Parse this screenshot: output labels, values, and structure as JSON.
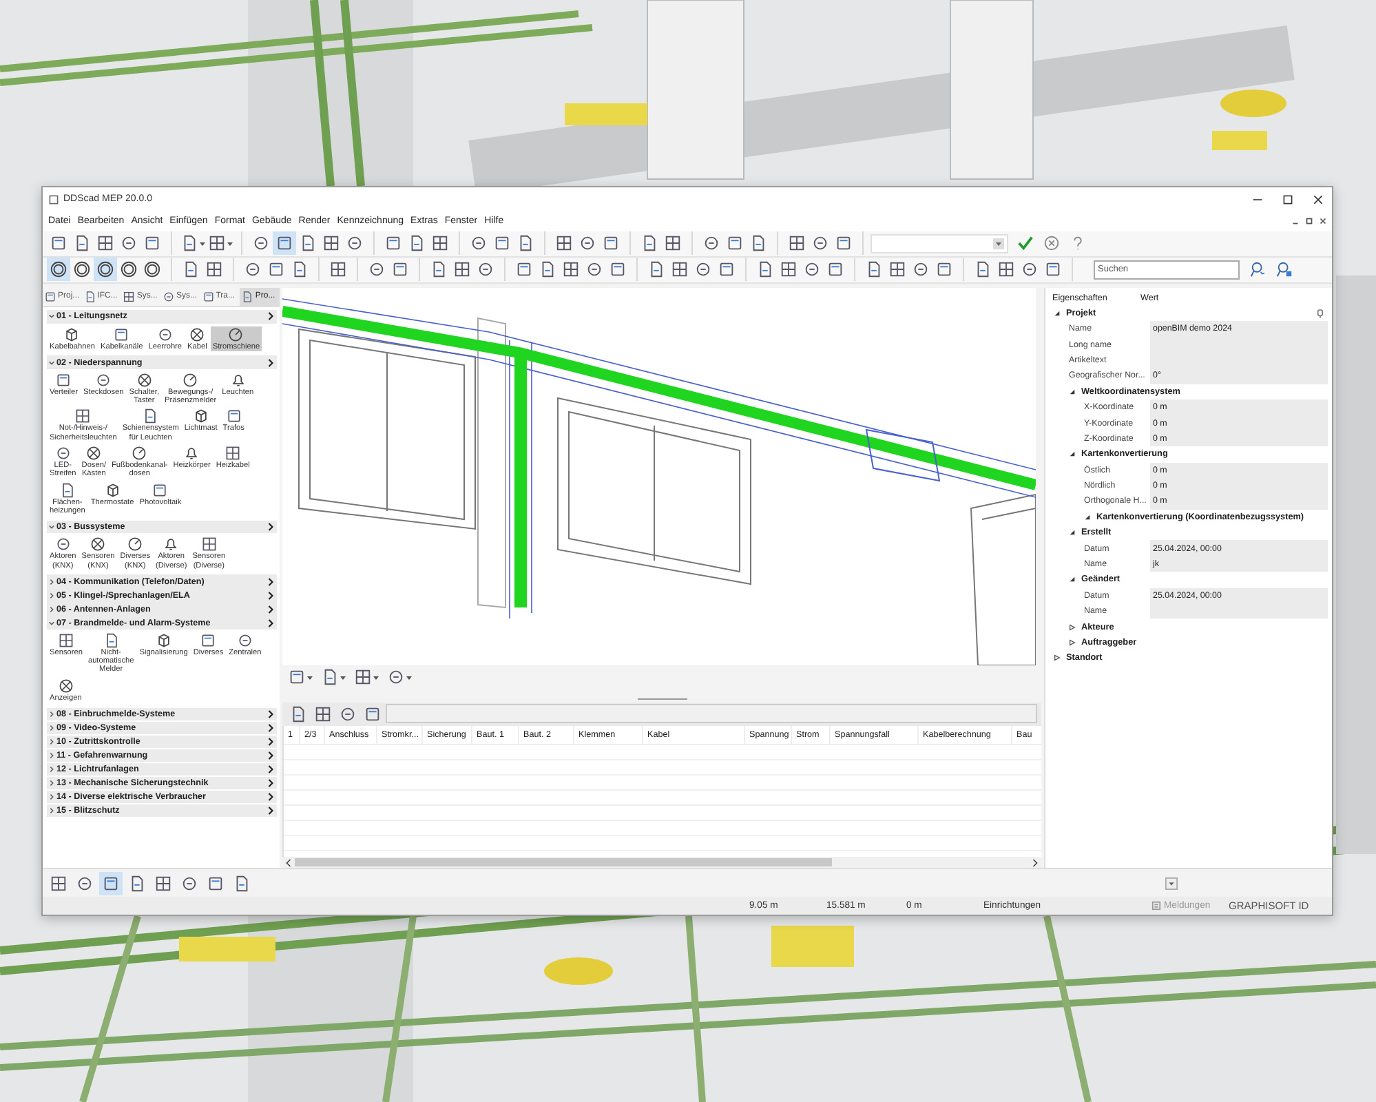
{
  "window": {
    "title": "DDScad MEP 20.0.0"
  },
  "menu": [
    "Datei",
    "Bearbeiten",
    "Ansicht",
    "Einfügen",
    "Format",
    "Gebäude",
    "Render",
    "Kennzeichnung",
    "Extras",
    "Fenster",
    "Hilfe"
  ],
  "toolbar": {
    "rows": [
      [
        [
          {
            "kind": "button",
            "selected": false
          },
          {
            "kind": "button",
            "selected": false
          },
          {
            "kind": "button",
            "selected": false
          },
          {
            "kind": "button",
            "selected": false
          },
          {
            "kind": "button",
            "selected": false
          }
        ],
        [
          {
            "kind": "split",
            "selected": false
          },
          {
            "kind": "split",
            "selected": false
          }
        ],
        [
          {
            "kind": "button",
            "selected": false
          },
          {
            "kind": "button",
            "selected": true
          },
          {
            "kind": "button",
            "selected": false
          },
          {
            "kind": "button",
            "selected": false
          },
          {
            "kind": "button",
            "selected": false
          }
        ],
        [
          {
            "kind": "button",
            "selected": false
          },
          {
            "kind": "button",
            "selected": false
          },
          {
            "kind": "button",
            "selected": false
          }
        ],
        [
          {
            "kind": "button",
            "selected": false
          },
          {
            "kind": "button",
            "selected": false
          },
          {
            "kind": "button",
            "selected": false
          }
        ],
        [
          {
            "kind": "button",
            "selected": false
          },
          {
            "kind": "button",
            "selected": false
          },
          {
            "kind": "button",
            "selected": false
          }
        ],
        [
          {
            "kind": "button",
            "selected": false
          },
          {
            "kind": "button",
            "selected": false
          }
        ],
        [
          {
            "kind": "button",
            "selected": false
          },
          {
            "kind": "button",
            "selected": false
          },
          {
            "kind": "button",
            "selected": false
          }
        ],
        [
          {
            "kind": "button",
            "selected": false
          },
          {
            "kind": "button",
            "selected": false
          },
          {
            "kind": "button",
            "selected": false
          }
        ]
      ],
      [
        [
          {
            "kind": "button",
            "selected": true
          },
          {
            "kind": "button",
            "selected": false
          },
          {
            "kind": "button",
            "selected": true
          },
          {
            "kind": "button",
            "selected": false
          },
          {
            "kind": "button",
            "selected": false
          }
        ],
        [
          {
            "kind": "button",
            "selected": false
          },
          {
            "kind": "button",
            "selected": false
          }
        ],
        [
          {
            "kind": "button",
            "selected": false
          },
          {
            "kind": "button",
            "selected": false
          },
          {
            "kind": "button",
            "selected": false
          }
        ],
        [
          {
            "kind": "button",
            "selected": false
          }
        ],
        [
          {
            "kind": "button",
            "selected": false
          },
          {
            "kind": "button",
            "selected": false
          }
        ],
        [
          {
            "kind": "button",
            "selected": false
          },
          {
            "kind": "button",
            "selected": false
          },
          {
            "kind": "button",
            "selected": false
          }
        ],
        [
          {
            "kind": "button",
            "selected": false
          },
          {
            "kind": "button",
            "selected": false
          },
          {
            "kind": "button",
            "selected": false
          },
          {
            "kind": "button",
            "selected": false
          },
          {
            "kind": "button",
            "selected": false
          }
        ],
        [
          {
            "kind": "button",
            "selected": false
          },
          {
            "kind": "button",
            "selected": false
          },
          {
            "kind": "button",
            "selected": false
          },
          {
            "kind": "button",
            "selected": false
          }
        ],
        [
          {
            "kind": "button",
            "selected": false
          },
          {
            "kind": "button",
            "selected": false
          },
          {
            "kind": "button",
            "selected": false
          },
          {
            "kind": "button",
            "selected": false
          }
        ],
        [
          {
            "kind": "button",
            "selected": false
          },
          {
            "kind": "button",
            "selected": false
          },
          {
            "kind": "button",
            "selected": false
          },
          {
            "kind": "button",
            "selected": false
          }
        ],
        [
          {
            "kind": "button",
            "selected": false
          },
          {
            "kind": "button",
            "selected": false
          },
          {
            "kind": "button",
            "selected": false
          },
          {
            "kind": "button",
            "selected": false
          }
        ]
      ]
    ]
  },
  "search": {
    "placeholder": "Suchen"
  },
  "panel_tabs": [
    {
      "label": "Proj...",
      "selected": false
    },
    {
      "label": "IFC...",
      "selected": false
    },
    {
      "label": "Sys...",
      "selected": false
    },
    {
      "label": "Sys...",
      "selected": false
    },
    {
      "label": "Tra...",
      "selected": false
    },
    {
      "label": "Pro...",
      "selected": true
    }
  ],
  "categories": [
    {
      "title": "01 - Leitungsnetz",
      "expanded": true,
      "items": [
        {
          "label": "Kabelbahnen",
          "selected": false
        },
        {
          "label": "Kabelkanäle",
          "selected": false
        },
        {
          "label": "Leerrohre",
          "selected": false
        },
        {
          "label": "Kabel",
          "selected": false
        },
        {
          "label": "Stromschiene",
          "selected": true
        }
      ]
    },
    {
      "title": "02 - Niederspannung",
      "expanded": true,
      "items": [
        {
          "label": "Verteiler",
          "selected": false
        },
        {
          "label": "Steckdosen",
          "selected": false
        },
        {
          "label": "Schalter, Taster",
          "selected": false
        },
        {
          "label": "Bewegungs-/ Präsenzmelder",
          "selected": false
        },
        {
          "label": "Leuchten",
          "selected": false
        },
        {
          "label": "Not-/Hinweis-/ Sicherheitsleuchten",
          "selected": false
        },
        {
          "label": "Schienensystem für Leuchten",
          "selected": false
        },
        {
          "label": "Lichtmast",
          "selected": false
        },
        {
          "label": "Trafos",
          "selected": false
        },
        {
          "label": "LED-Streifen",
          "selected": false
        },
        {
          "label": "Dosen/ Kästen",
          "selected": false
        },
        {
          "label": "Fußbodenkanal-dosen",
          "selected": false
        },
        {
          "label": "Heizkörper",
          "selected": false
        },
        {
          "label": "Heizkabel",
          "selected": false
        },
        {
          "label": "Flächen-heizungen",
          "selected": false
        },
        {
          "label": "Thermostate",
          "selected": false
        },
        {
          "label": "Photovoltaik",
          "selected": false
        }
      ]
    },
    {
      "title": "03 - Bussysteme",
      "expanded": true,
      "items": [
        {
          "label": "Aktoren (KNX)",
          "selected": false
        },
        {
          "label": "Sensoren (KNX)",
          "selected": false
        },
        {
          "label": "Diverses (KNX)",
          "selected": false
        },
        {
          "label": "Aktoren (Diverse)",
          "selected": false
        },
        {
          "label": "Sensoren (Diverse)",
          "selected": false
        }
      ]
    },
    {
      "title": "04 - Kommunikation (Telefon/Daten)",
      "expanded": false
    },
    {
      "title": "05 - Klingel-/Sprechanlagen/ELA",
      "expanded": false
    },
    {
      "title": "06 - Antennen-Anlagen",
      "expanded": false
    },
    {
      "title": "07 - Brandmelde- und Alarm-Systeme",
      "expanded": true,
      "items": [
        {
          "label": "Sensoren",
          "selected": false
        },
        {
          "label": "Nicht-automatische Melder",
          "selected": false
        },
        {
          "label": "Signalisierung",
          "selected": false
        },
        {
          "label": "Diverses",
          "selected": false
        },
        {
          "label": "Zentralen",
          "selected": false
        },
        {
          "label": "Anzeigen",
          "selected": false
        }
      ]
    },
    {
      "title": "08 - Einbruchmelde-Systeme",
      "expanded": false
    },
    {
      "title": "09 - Video-Systeme",
      "expanded": false
    },
    {
      "title": "10 - Zutrittskontrolle",
      "expanded": false
    },
    {
      "title": "11 - Gefahrenwarnung",
      "expanded": false
    },
    {
      "title": "12 - Lichtrufanlagen",
      "expanded": false
    },
    {
      "title": "13 - Mechanische Sicherungstechnik",
      "expanded": false
    },
    {
      "title": "14 - Diverse elektrische Verbraucher",
      "expanded": false
    },
    {
      "title": "15 - Blitzschutz",
      "expanded": false
    }
  ],
  "panel_tools": [
    {
      "selected": false
    },
    {
      "selected": false
    },
    {
      "selected": true
    },
    {
      "selected": false
    },
    {
      "selected": false
    },
    {
      "selected": false
    },
    {
      "selected": false
    },
    {
      "selected": false
    }
  ],
  "table": {
    "columns": [
      "1",
      "2/3",
      "Anschluss",
      "Stromkr...",
      "Sicherung",
      "Baut. 1",
      "Baut. 2",
      "Klemmen",
      "Kabel",
      "Spannung",
      "Strom",
      "Spannungsfall",
      "Kabelberechnung",
      "Bau"
    ]
  },
  "properties": {
    "columns": [
      "Eigenschaften",
      "Wert"
    ],
    "rows": [
      {
        "label": "Projekt",
        "expanded": true,
        "children": [
          {
            "label": "Name",
            "value": "openBIM demo 2024"
          },
          {
            "label": "Long name"
          },
          {
            "label": "Artikeltext"
          },
          {
            "label": "Geografischer Nor...",
            "value": "0°"
          },
          {
            "label": "Weltkoordinatensystem",
            "expanded": true,
            "children": [
              {
                "label": "X-Koordinate",
                "value": "0 m"
              },
              {
                "label": "Y-Koordinate",
                "value": "0 m"
              },
              {
                "label": "Z-Koordinate",
                "value": "0 m"
              }
            ]
          },
          {
            "label": "Kartenkonvertierung",
            "expanded": true,
            "children": [
              {
                "label": "Östlich",
                "value": "0 m"
              },
              {
                "label": "Nördlich",
                "value": "0 m"
              },
              {
                "label": "Orthogonale H...",
                "value": "0 m"
              },
              {
                "label": "Kartenkonvertierung (Koordinatenbezugssystem)",
                "expanded": true
              }
            ]
          },
          {
            "label": "Erstellt",
            "expanded": true,
            "children": [
              {
                "label": "Datum",
                "value": "25.04.2024, 00:00"
              },
              {
                "label": "Name",
                "value": "jk"
              }
            ]
          },
          {
            "label": "Geändert",
            "expanded": true,
            "children": [
              {
                "label": "Datum",
                "value": "25.04.2024, 00:00"
              },
              {
                "label": "Name"
              }
            ]
          },
          {
            "label": "Akteure",
            "expanded": false
          },
          {
            "label": "Auftraggeber",
            "expanded": false
          }
        ]
      },
      {
        "label": "Standort",
        "expanded": false
      }
    ]
  },
  "status_bar": {
    "x": "9.05 m",
    "y": "15.581 m",
    "z": "0 m",
    "mode": "Einrichtungen",
    "messages": "Meldungen",
    "account": "GRAPHISOFT ID"
  }
}
